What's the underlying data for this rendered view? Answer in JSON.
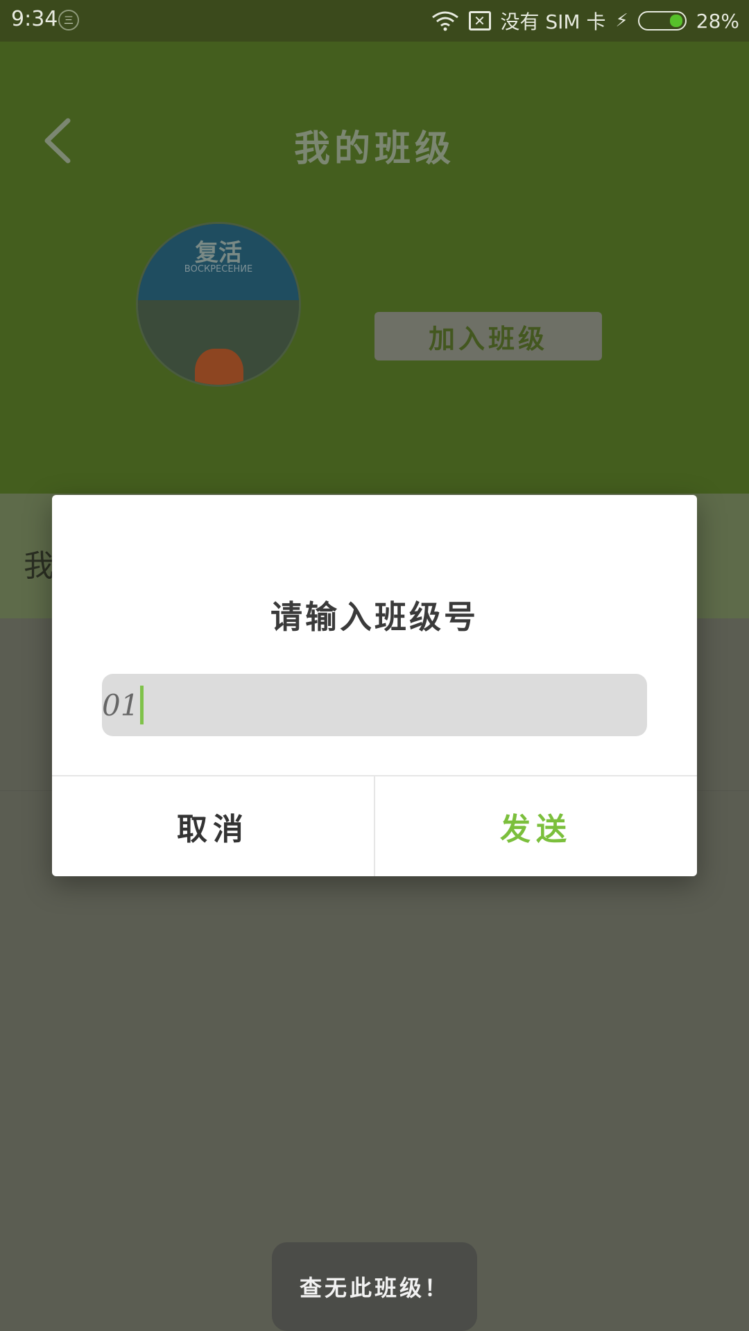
{
  "status_bar": {
    "time": "9:34",
    "notification_badge": "三",
    "sim_status": "没有 SIM 卡",
    "battery_percent": "28%",
    "battery_level": 0.28,
    "icons": [
      "wifi-icon",
      "no-sim-icon",
      "charging-bolt-icon",
      "battery-icon"
    ]
  },
  "header": {
    "title": "我的班级",
    "back_icon": "chevron-left-icon",
    "avatar": {
      "book_title": "复活",
      "book_subtitle": "ВОСКРЕСЕНИЕ"
    },
    "join_button": "加入班级"
  },
  "section": {
    "label": "我"
  },
  "dialog": {
    "title": "请输入班级号",
    "input_value": "01",
    "cancel_button": "取消",
    "send_button": "发送"
  },
  "toast": {
    "message": "查无此班级！"
  },
  "colors": {
    "header_bg": "#445e1e",
    "accent_green": "#7bbf3c",
    "dim_bg": "#5b5d52"
  }
}
